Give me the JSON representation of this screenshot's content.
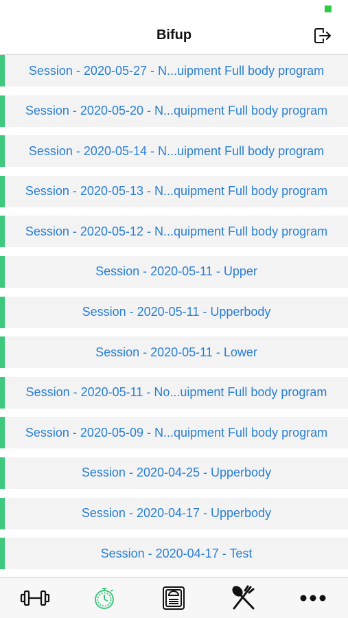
{
  "status": {
    "battery_color": "#2ecc40"
  },
  "nav": {
    "title": "Bifup",
    "logout_icon": "logout-icon"
  },
  "sessions": [
    "Session - 2020-05-27 - N...uipment Full body program",
    "Session - 2020-05-20 - N...quipment Full body program",
    "Session - 2020-05-14 - N...uipment Full body program",
    "Session - 2020-05-13 - N...quipment Full body program",
    "Session - 2020-05-12 - N...quipment Full body program",
    "Session - 2020-05-11 - Upper",
    "Session - 2020-05-11 - Upperbody",
    "Session - 2020-05-11 - Lower",
    "Session - 2020-05-11 - No...uipment Full body program",
    "Session - 2020-05-09 - N...quipment Full body program",
    "Session - 2020-04-25 - Upperbody",
    "Session - 2020-04-17 - Upperbody",
    "Session - 2020-04-17 - Test"
  ],
  "colors": {
    "accent": "#3ec97e",
    "link": "#2a7fd4",
    "row_bg": "#f3f3f3"
  },
  "tabs": [
    {
      "icon": "dumbbell-icon",
      "active": false
    },
    {
      "icon": "stopwatch-icon",
      "active": true
    },
    {
      "icon": "scale-icon",
      "active": false
    },
    {
      "icon": "fork-spoon-icon",
      "active": false
    },
    {
      "icon": "more-icon",
      "active": false
    }
  ]
}
